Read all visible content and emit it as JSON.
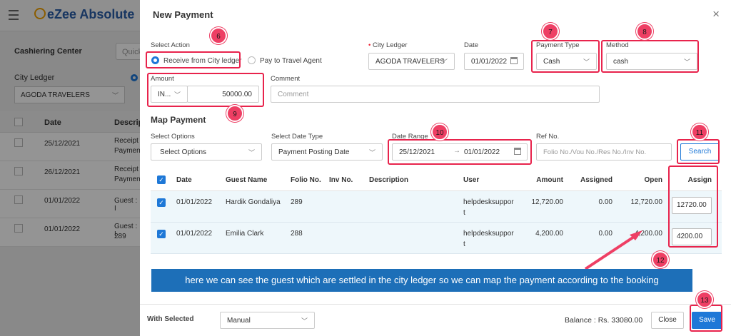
{
  "background": {
    "app_name": "eZee Absolute",
    "page_title": "Cashiering Center",
    "quick_placeholder": "Quick",
    "section_label": "City Ledger",
    "select_value": "AGODA TRAVELERS",
    "table_headers": [
      "Date",
      "Descript"
    ],
    "rows": [
      {
        "date": "25/12/2021",
        "desc_line1": "Receipt",
        "desc_line2": "Paymen"
      },
      {
        "date": "26/12/2021",
        "desc_line1": "Receipt",
        "desc_line2": "Paymen"
      },
      {
        "date": "01/01/2022",
        "desc_line1": "Guest : I",
        "desc_line2": ""
      },
      {
        "date": "01/01/2022",
        "desc_line1": "Guest : I",
        "desc_line2": "289"
      }
    ]
  },
  "modal": {
    "title": "New Payment",
    "close_symbol": "×",
    "select_action_label": "Select Action",
    "action_options": [
      "Receive from City ledger",
      "Pay to Travel Agent"
    ],
    "city_ledger_label": "City Ledger",
    "city_ledger_value": "AGODA TRAVELERS",
    "date_label": "Date",
    "date_value": "01/01/2022",
    "payment_type_label": "Payment Type",
    "payment_type_value": "Cash",
    "method_label": "Method",
    "method_value": "cash",
    "amount_label": "Amount",
    "currency_value": "IN...",
    "amount_value": "50000.00",
    "comment_label": "Comment",
    "comment_placeholder": "Comment",
    "map_payment_title": "Map Payment",
    "select_options_label": "Select Options",
    "select_options_value": "Select Options",
    "date_type_label": "Select Date Type",
    "date_type_value": "Payment Posting Date",
    "date_range_label": "Date Range",
    "date_range_from": "25/12/2021",
    "date_range_to": "01/01/2022",
    "ref_label": "Ref No.",
    "ref_placeholder": "Folio No./Vou No./Res No./Inv No.",
    "search_label": "Search",
    "grid_headers": {
      "date": "Date",
      "guest": "Guest Name",
      "folio": "Folio No.",
      "inv": "Inv No.",
      "desc": "Description",
      "user": "User",
      "amount": "Amount",
      "assigned": "Assigned",
      "open": "Open",
      "assign": "Assign"
    },
    "grid_rows": [
      {
        "date": "01/01/2022",
        "guest": "Hardik Gondaliya",
        "folio": "289",
        "user_line1": "helpdesksuppor",
        "user_line2": "t",
        "amount": "12,720.00",
        "assigned": "0.00",
        "open": "12,720.00",
        "assign": "12720.00"
      },
      {
        "date": "01/01/2022",
        "guest": "Emilia Clark",
        "folio": "288",
        "user_line1": "helpdesksuppor",
        "user_line2": "t",
        "amount": "4,200.00",
        "assigned": "0.00",
        "open": "4,200.00",
        "assign": "4200.00"
      }
    ],
    "with_selected_label": "With Selected",
    "with_selected_value": "Manual",
    "balance": "Balance : Rs. 33080.00",
    "close_label": "Close",
    "save_label": "Save"
  },
  "annotations": {
    "badges": [
      "6",
      "7",
      "8",
      "9",
      "10",
      "11",
      "12",
      "13"
    ],
    "banner_text": "here we can see the guest which are settled in the city ledger so we can map the payment according to the booking",
    "highlight_color": "#e8234c",
    "banner_color": "#1d6fb8"
  },
  "colors": {
    "accent": "#1e78d7"
  }
}
